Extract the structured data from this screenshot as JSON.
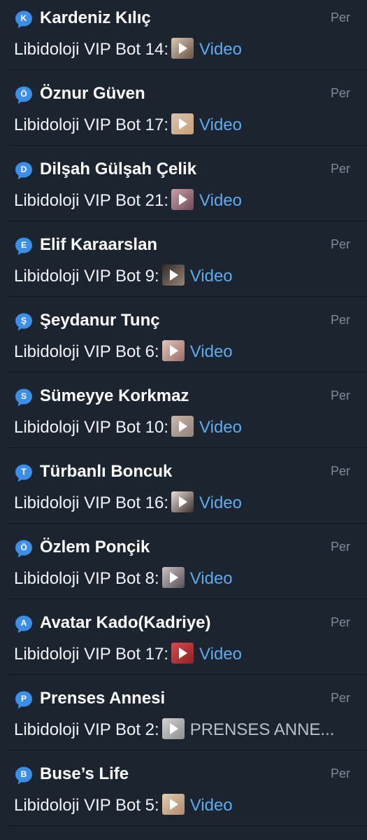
{
  "chats": [
    {
      "badge": "K",
      "name": "Kardeniz Kılıç",
      "time": "Per",
      "sender": "Libidoloji VIP Bot 14:",
      "preview": "Video",
      "muted": false,
      "thumb_colors": [
        "#d9c8b2",
        "#6a5345"
      ]
    },
    {
      "badge": "Ö",
      "name": "Öznur Güven",
      "time": "Per",
      "sender": "Libidoloji VIP Bot 17:",
      "preview": "Video",
      "muted": false,
      "thumb_colors": [
        "#d9c4ae",
        "#c99f7b"
      ]
    },
    {
      "badge": "D",
      "name": "Dilşah Gülşah Çelik",
      "time": "Per",
      "sender": "Libidoloji VIP Bot 21:",
      "preview": "Video",
      "muted": false,
      "thumb_colors": [
        "#ca9ea7",
        "#6e4b58"
      ]
    },
    {
      "badge": "E",
      "name": "Elif Karaarslan",
      "time": "Per",
      "sender": "Libidoloji VIP Bot 9:",
      "preview": "Video",
      "muted": false,
      "thumb_colors": [
        "#302b29",
        "#9a8575"
      ]
    },
    {
      "badge": "Ş",
      "name": "Şeydanur Tunç",
      "time": "Per",
      "sender": "Libidoloji VIP Bot 6:",
      "preview": "Video",
      "muted": false,
      "thumb_colors": [
        "#e1c6bd",
        "#9b6c66"
      ]
    },
    {
      "badge": "S",
      "name": "Sümeyye Korkmaz",
      "time": "Per",
      "sender": "Libidoloji VIP Bot 10:",
      "preview": "Video",
      "muted": false,
      "thumb_colors": [
        "#cbb7ac",
        "#8f8179"
      ]
    },
    {
      "badge": "T",
      "name": "Türbanlı Boncuk",
      "time": "Per",
      "sender": "Libidoloji VIP Bot 16:",
      "preview": "Video",
      "muted": false,
      "thumb_colors": [
        "#e9e1d7",
        "#3a302d"
      ]
    },
    {
      "badge": "Ö",
      "name": "Özlem Ponçik",
      "time": "Per",
      "sender": "Libidoloji VIP Bot 8:",
      "preview": "Video",
      "muted": false,
      "thumb_colors": [
        "#c9c2c3",
        "#584f55"
      ]
    },
    {
      "badge": "A",
      "name": "Avatar Kado(Kadriye)",
      "time": "Per",
      "sender": "Libidoloji VIP Bot 17:",
      "preview": "Video",
      "muted": false,
      "thumb_colors": [
        "#d8494b",
        "#8b2424"
      ]
    },
    {
      "badge": "P",
      "name": "Prenses Annesi",
      "time": "Per",
      "sender": "Libidoloji VIP Bot 2:",
      "preview": "PRENSES ANNE...",
      "muted": true,
      "thumb_colors": [
        "#d1d1d1",
        "#8f8f8f"
      ]
    },
    {
      "badge": "B",
      "name": "Buse’s Life",
      "time": "Per",
      "sender": "Libidoloji VIP Bot 5:",
      "preview": "Video",
      "muted": false,
      "thumb_colors": [
        "#e0cdb7",
        "#b18a68"
      ]
    }
  ],
  "colors": {
    "background": "#1c2430",
    "badge": "#3d8ee6",
    "link": "#5cabf0",
    "time": "#7f8b98"
  }
}
